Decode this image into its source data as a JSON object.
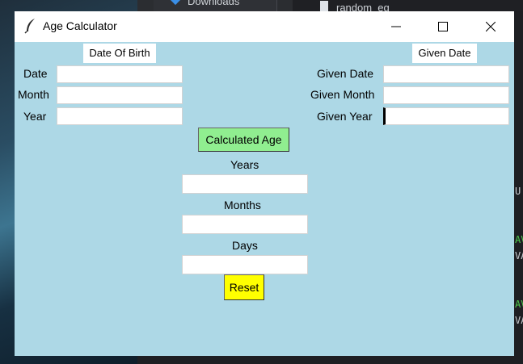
{
  "background": {
    "tab_downloads": "Downloads",
    "tab_file": "random_eg",
    "code_fragments": [
      "U",
      "AV",
      "VA",
      "AV",
      "VA"
    ]
  },
  "window": {
    "title": "Age Calculator",
    "controls": {
      "minimize": "—",
      "maximize": "☐",
      "close": "✕"
    }
  },
  "dob": {
    "header": "Date Of Birth",
    "date_label": "Date",
    "month_label": "Month",
    "year_label": "Year",
    "date_value": "",
    "month_value": "",
    "year_value": ""
  },
  "given": {
    "header": "Given Date",
    "date_label": "Given Date",
    "month_label": "Given Month",
    "year_label": "Given Year",
    "date_value": "",
    "month_value": "",
    "year_value": ""
  },
  "actions": {
    "calculate_label": "Calculated Age",
    "reset_label": "Reset"
  },
  "results": {
    "years_label": "Years",
    "months_label": "Months",
    "days_label": "Days",
    "years_value": "",
    "months_value": "",
    "days_value": ""
  },
  "colors": {
    "window_bg": "#add8e6",
    "calculate_bg": "#90ee90",
    "reset_bg": "#ffff00"
  }
}
